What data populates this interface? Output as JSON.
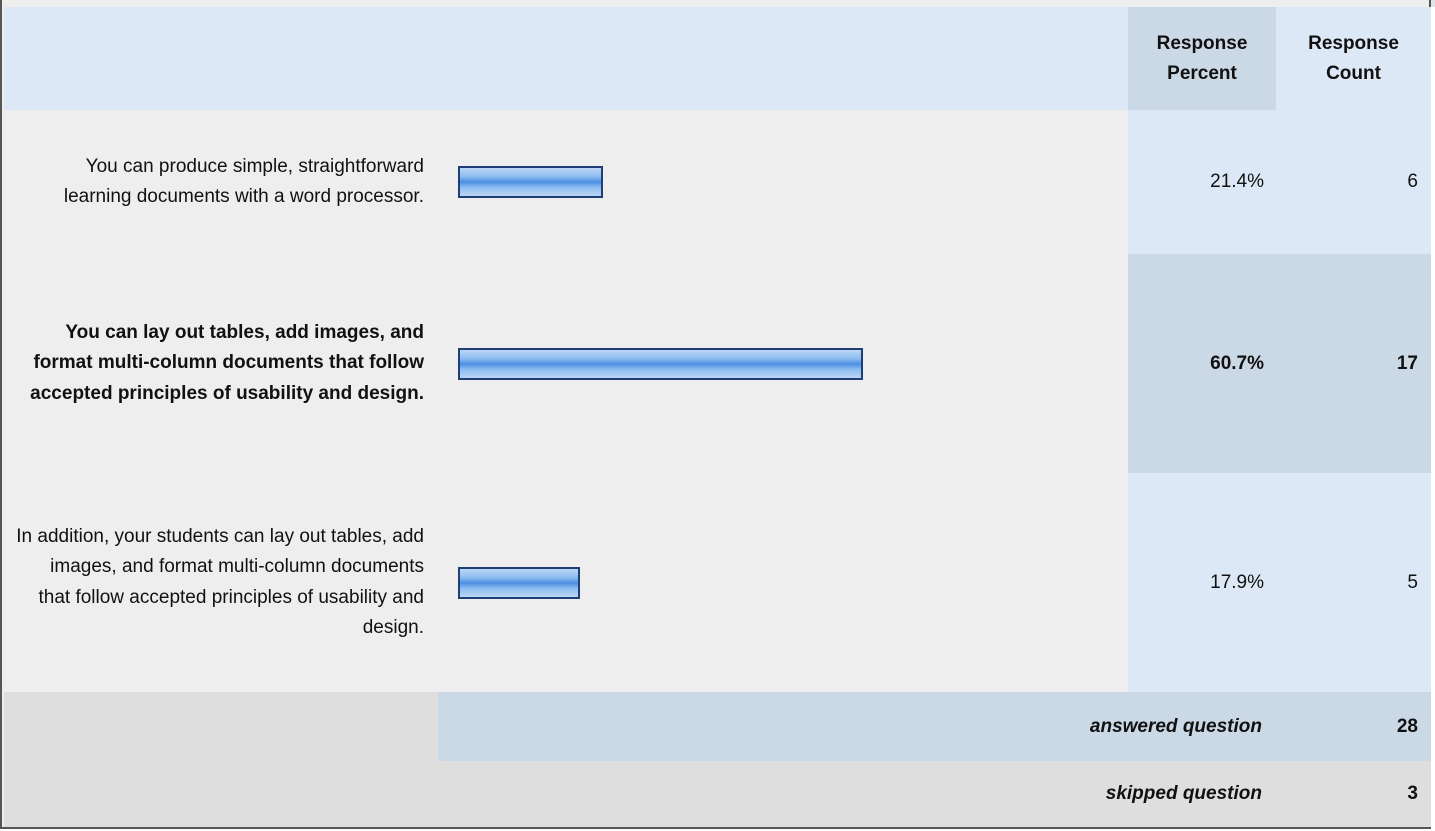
{
  "chart_data": {
    "type": "bar",
    "orientation": "horizontal",
    "columns": [
      "Response Percent",
      "Response Count"
    ],
    "categories": [
      "You can produce simple, straightforward learning documents with a word processor.",
      "You can lay out tables, add images, and format multi-column documents that follow accepted principles of usability and design.",
      "In addition, your students can lay out tables, add images, and format multi-column documents that follow accepted principles of usability and design."
    ],
    "percent_values": [
      21.4,
      60.7,
      17.9
    ],
    "count_values": [
      6,
      17,
      5
    ],
    "bold_row": 1,
    "xlim": [
      0,
      100
    ]
  },
  "header": {
    "percent_label": "Response Percent",
    "count_label": "Response Count"
  },
  "rows": [
    {
      "label": "You can produce simple, straightforward learning documents with a word processor.",
      "percent": "21.4%",
      "count": "6"
    },
    {
      "label": "You can lay out tables, add images, and format multi-column documents that follow accepted principles of usability and design.",
      "percent": "60.7%",
      "count": "17"
    },
    {
      "label": "In addition, your students can lay out tables, add images, and format multi-column documents that follow accepted principles of usability and design.",
      "percent": "17.9%",
      "count": "5"
    }
  ],
  "footer": {
    "answered_label": "answered question",
    "answered_value": "28",
    "skipped_label": "skipped question",
    "skipped_value": "3"
  },
  "colors": {
    "header_bg": "#dce8f6",
    "row_bg": "#eeeeee",
    "pct_col_bg": "#dce8f6",
    "highlight_bg": "#cbd8e6",
    "footer_bg": "#dedede",
    "bar_border": "#1f3e76",
    "bar_fill": "#6ea5ea"
  }
}
